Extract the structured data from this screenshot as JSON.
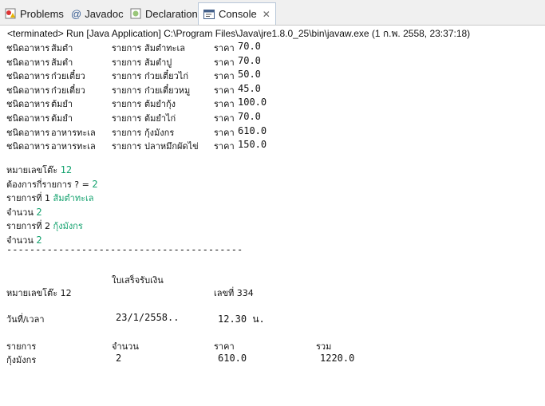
{
  "tabs": [
    {
      "label": "Problems",
      "icon": "problems-icon"
    },
    {
      "label": "Javadoc",
      "icon": "at-icon"
    },
    {
      "label": "Declaration",
      "icon": "declaration-icon"
    },
    {
      "label": "Console",
      "icon": "console-icon",
      "close": "✕"
    }
  ],
  "status": "<terminated> Run [Java Application] C:\\Program Files\\Java\\jre1.8.0_25\\bin\\javaw.exe (1 ก.พ. 2558, 23:37:18)",
  "menu": [
    {
      "type_label": "ชนิดอาหาร",
      "type": "ส้มตำ",
      "item_label": "รายการ",
      "item": "ส้มตำทะเล",
      "price_label": "ราคา",
      "price": "70.0"
    },
    {
      "type_label": "ชนิดอาหาร",
      "type": "ส้มตำ",
      "item_label": "รายการ",
      "item": "ส้มตำปู",
      "price_label": "ราคา",
      "price": "70.0"
    },
    {
      "type_label": "ชนิดอาหาร",
      "type": "ก๋วยเตี๋ยว",
      "item_label": "รายการ",
      "item": "ก๋วยเตี๋ยวไก่",
      "price_label": "ราคา",
      "price": "50.0"
    },
    {
      "type_label": "ชนิดอาหาร",
      "type": "ก๋วยเตี๋ยว",
      "item_label": "รายการ",
      "item": "ก๋วยเตี๋ยวหมู",
      "price_label": "ราคา",
      "price": "45.0"
    },
    {
      "type_label": "ชนิดอาหาร",
      "type": "ต้มยำ",
      "item_label": "รายการ",
      "item": "ต้มยำกุ้ง",
      "price_label": "ราคา",
      "price": "100.0"
    },
    {
      "type_label": "ชนิดอาหาร",
      "type": "ต้มยำ",
      "item_label": "รายการ",
      "item": "ต้มยำไก่",
      "price_label": "ราคา",
      "price": "70.0"
    },
    {
      "type_label": "ชนิดอาหาร",
      "type": "อาหารทะเล",
      "item_label": "รายการ",
      "item": "กุ้งมังกร",
      "price_label": "ราคา",
      "price": "610.0"
    },
    {
      "type_label": "ชนิดอาหาร",
      "type": "อาหารทะเล",
      "item_label": "รายการ",
      "item": "ปลาหมึกผัดไข่",
      "price_label": "ราคา",
      "price": "150.0"
    }
  ],
  "input": {
    "table_label": "หมายเลขโต๊ะ ",
    "table_value": "12",
    "count_label": "ต้องการกี่รายการ ? = ",
    "count_value": "2",
    "item1_label": "รายการที่ 1 ",
    "item1_value": "ส้มตำทะเล",
    "qty1_label": "จำนวน ",
    "qty1_value": "2",
    "item2_label": "รายการที่ 2 ",
    "item2_value": "กุ้งมังกร",
    "qty2_label": "จำนวน ",
    "qty2_value": "2",
    "separator": "-----------------------------------------"
  },
  "receipt": {
    "title": "ใบเสร็จรับเงิน",
    "table": "หมายเลขโต๊ะ 12",
    "number": "เลขที่ 334",
    "datetime_label": "วันที่/เวลา",
    "date": "23/1/2558..",
    "time": "12.30 น.",
    "headers": [
      "รายการ",
      "จำนวน",
      "ราคา",
      "รวม"
    ],
    "row": {
      "item": "กุ้งมังกร",
      "qty": "2",
      "price": "610.0",
      "total": "1220.0"
    }
  }
}
